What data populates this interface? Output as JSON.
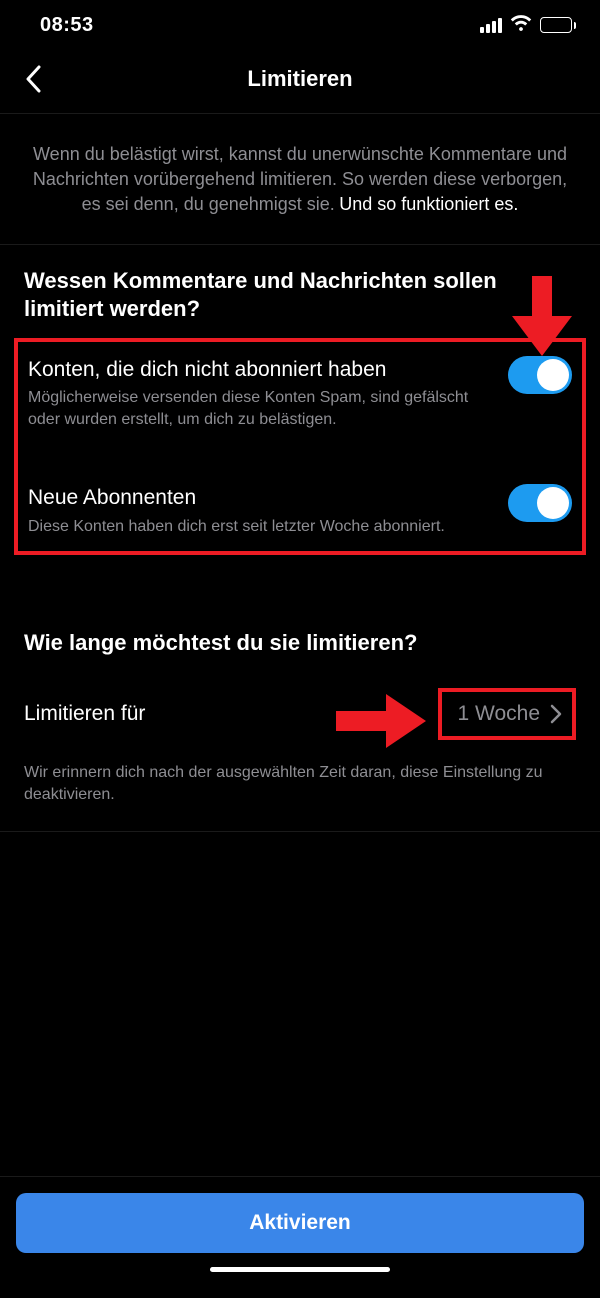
{
  "status": {
    "time": "08:53"
  },
  "nav": {
    "title": "Limitieren"
  },
  "intro": {
    "gray": "Wenn du belästigt wirst, kannst du unerwünschte Kommentare und Nachrichten vorübergehend limitieren. So werden diese verborgen, es sei denn, du genehmigst sie.",
    "white": "Und so funktioniert es."
  },
  "section1": {
    "heading": "Wessen Kommentare und Nachrichten sollen limitiert werden?",
    "items": [
      {
        "title": "Konten, die dich nicht abonniert haben",
        "desc": "Möglicherweise versenden diese Konten Spam, sind gefälscht oder wurden erstellt, um dich zu belästigen."
      },
      {
        "title": "Neue Abonnenten",
        "desc": "Diese Konten haben dich erst seit letzter Woche abonniert."
      }
    ]
  },
  "section2": {
    "heading": "Wie lange möchtest du sie limitieren?",
    "row_label": "Limitieren für",
    "row_value": "1 Woche",
    "reminder": "Wir erinnern dich nach der ausgewählten Zeit daran, diese Einstellung zu deaktivieren."
  },
  "activate": {
    "label": "Aktivieren"
  }
}
